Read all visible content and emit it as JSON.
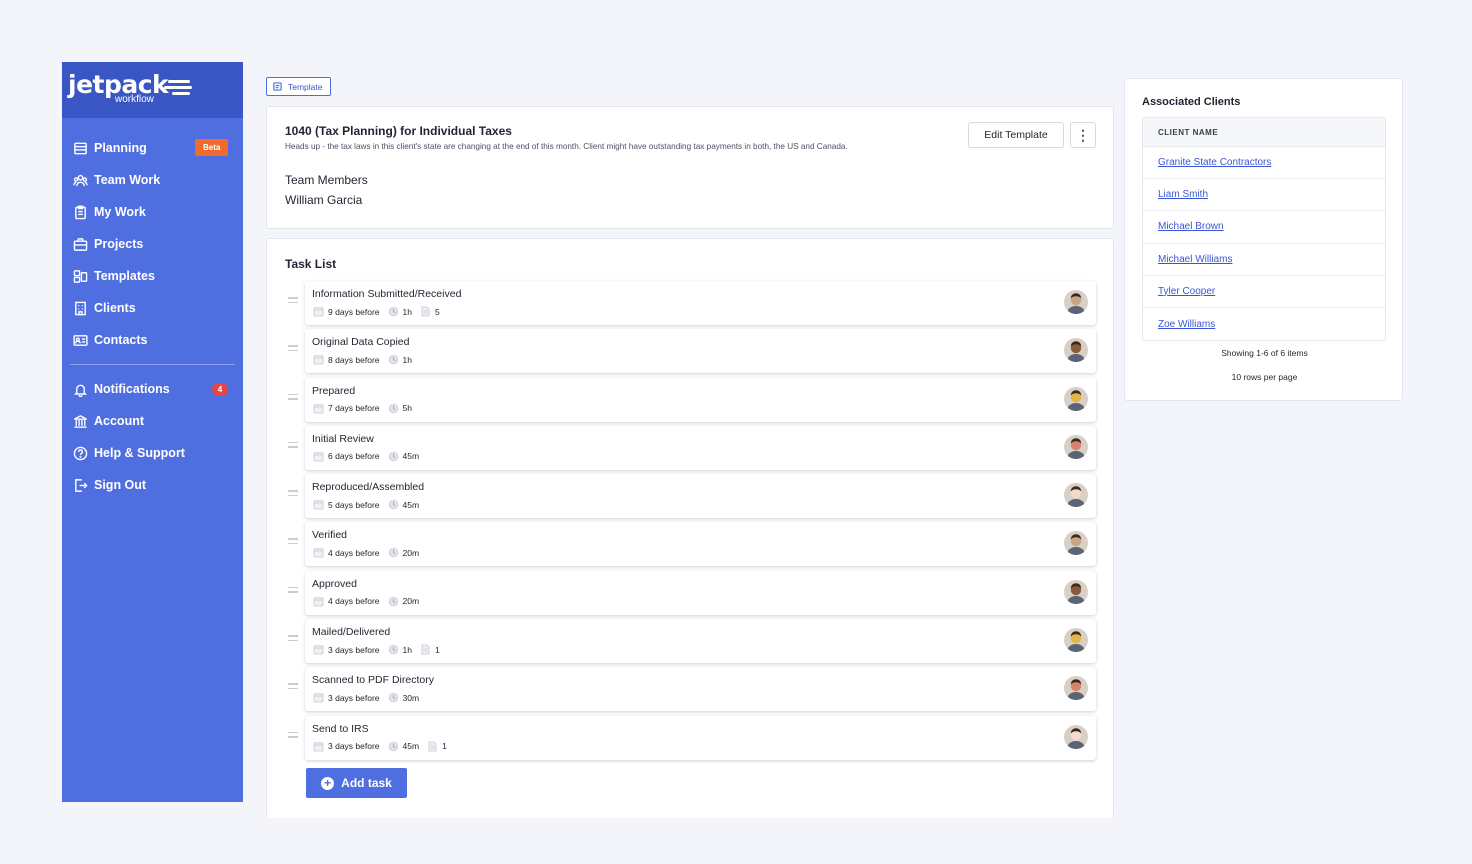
{
  "app": {
    "logo_main": "jetpack",
    "logo_sub": "workflow"
  },
  "sidebar": {
    "items": [
      {
        "label": "Planning",
        "icon": "list-icon",
        "badge": "Beta"
      },
      {
        "label": "Team Work",
        "icon": "team-icon"
      },
      {
        "label": "My Work",
        "icon": "clipboard-icon"
      },
      {
        "label": "Projects",
        "icon": "briefcase-icon"
      },
      {
        "label": "Templates",
        "icon": "templates-icon"
      },
      {
        "label": "Clients",
        "icon": "building-icon"
      },
      {
        "label": "Contacts",
        "icon": "contact-card-icon"
      }
    ],
    "secondary": [
      {
        "label": "Notifications",
        "icon": "bell-icon",
        "badge": "4"
      },
      {
        "label": "Account",
        "icon": "bank-icon"
      },
      {
        "label": "Help & Support",
        "icon": "help-icon"
      },
      {
        "label": "Sign Out",
        "icon": "sign-out-icon"
      }
    ]
  },
  "template_tag": "Template",
  "header": {
    "title": "1040 (Tax Planning) for Individual Taxes",
    "subtitle": "Heads up - the tax laws in this client's state are changing at the end of this month. Client might have outstanding tax payments in both, the US and Canada.",
    "team_members_label": "Team Members",
    "team_members_value": "William Garcia",
    "edit_button": "Edit Template",
    "more_icon": "more-vertical-icon"
  },
  "tasks": {
    "title": "Task List",
    "add_button": "Add task",
    "items": [
      {
        "name": "Information Submitted/Received",
        "due": "9 days before",
        "duration": "1h",
        "docs": "5",
        "avatar_tone": "#c8a585"
      },
      {
        "name": "Original Data Copied",
        "due": "8 days before",
        "duration": "1h",
        "docs": "",
        "avatar_tone": "#8a5a3a"
      },
      {
        "name": "Prepared",
        "due": "7 days before",
        "duration": "5h",
        "docs": "",
        "avatar_tone": "#e3b545"
      },
      {
        "name": "Initial Review",
        "due": "6 days before",
        "duration": "45m",
        "docs": "",
        "avatar_tone": "#d9816b"
      },
      {
        "name": "Reproduced/Assembled",
        "due": "5 days before",
        "duration": "45m",
        "docs": "",
        "avatar_tone": "#f2dcd0"
      },
      {
        "name": "Verified",
        "due": "4 days before",
        "duration": "20m",
        "docs": "",
        "avatar_tone": "#c8a585"
      },
      {
        "name": "Approved",
        "due": "4 days before",
        "duration": "20m",
        "docs": "",
        "avatar_tone": "#8a5a3a"
      },
      {
        "name": "Mailed/Delivered",
        "due": "3 days before",
        "duration": "1h",
        "docs": "1",
        "avatar_tone": "#e3b545"
      },
      {
        "name": "Scanned to PDF Directory",
        "due": "3 days before",
        "duration": "30m",
        "docs": "",
        "avatar_tone": "#d9816b"
      },
      {
        "name": "Send to IRS",
        "due": "3 days before",
        "duration": "45m",
        "docs": "1",
        "avatar_tone": "#f2dcd0"
      }
    ]
  },
  "clients": {
    "title": "Associated Clients",
    "column_header": "CLIENT NAME",
    "rows": [
      "Granite State Contractors",
      "Liam Smith",
      "Michael Brown",
      "Michael Williams",
      "Tyler Cooper",
      "Zoe Williams"
    ],
    "showing": "Showing 1-6 of 6 items",
    "rows_per_page": "10 rows per page"
  },
  "colors": {
    "brand": "#4f6ee0",
    "brand_dark": "#3a56c4",
    "beta_badge": "#f26b2e",
    "notification_badge": "#ea4545",
    "link": "#3a56d4"
  }
}
